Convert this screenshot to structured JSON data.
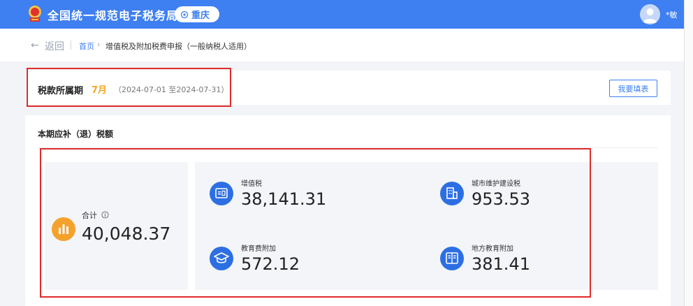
{
  "header": {
    "app_title": "全国统一规范电子税务局",
    "region": "重庆",
    "user_name": "*敏",
    "accent_color": "#3e7ff1"
  },
  "breadcrumb": {
    "back_label": "返回",
    "home_label": "首页",
    "current_label": "增值税及附加税费申报（一般纳税人适用）"
  },
  "period": {
    "label": "税款所属期",
    "month": "7月",
    "range": "（2024-07-01 至2024-07-31）",
    "fill_button": "我要填表"
  },
  "tax": {
    "title": "本期应补（退）税额",
    "total_label": "合计",
    "total_value": "40,048.37",
    "items": [
      {
        "name": "增值税",
        "value": "38,141.31",
        "icon": "tax-invoice-icon"
      },
      {
        "name": "城市维护建设税",
        "value": "953.53",
        "icon": "building-icon"
      },
      {
        "name": "教育费附加",
        "value": "572.12",
        "icon": "graduation-cap-icon"
      },
      {
        "name": "地方教育附加",
        "value": "381.41",
        "icon": "book-icon"
      }
    ]
  }
}
